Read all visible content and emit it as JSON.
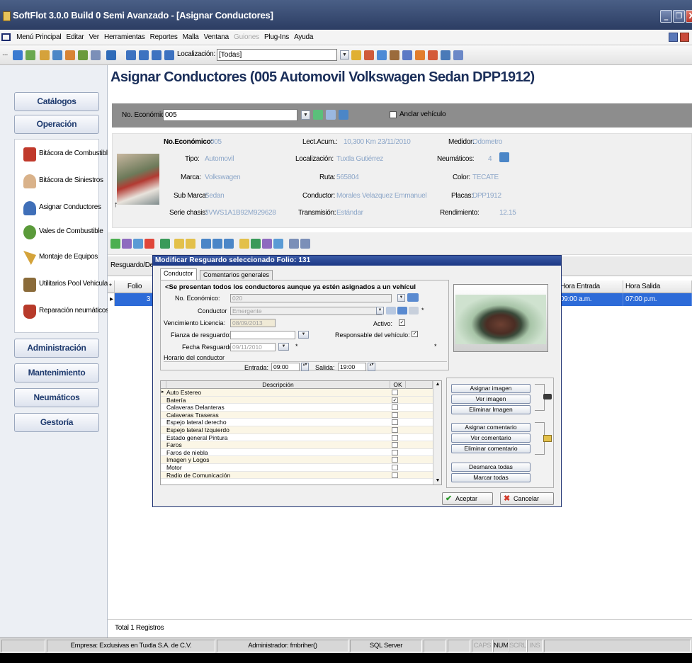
{
  "window": {
    "title": "SoftFlot 3.0.0 Build 0 Semi Avanzado - [Asignar Conductores]",
    "controls": [
      "_",
      "❐",
      "X"
    ]
  },
  "menubar": {
    "items": [
      "Menú Principal",
      "Editar",
      "Ver",
      "Herramientas",
      "Reportes",
      "Malla",
      "Ventana",
      "Guiones",
      "Plug-Ins",
      "Ayuda"
    ],
    "disabled_index": 7
  },
  "toolbar": {
    "prefix": "...",
    "location_label": "Localización:",
    "location_value": "[Todas]"
  },
  "sidebar": {
    "top_buttons": [
      "Catálogos",
      "Operación"
    ],
    "items": [
      "Bitácora de Combustible",
      "Bitácora de Siniestros",
      "Asignar Conductores",
      "Vales de Combustible",
      "Montaje de Equipos",
      "Utilitarios Pool Vehicular",
      "Reparación neumáticos"
    ],
    "bottom_buttons": [
      "Administración",
      "Mantenimiento",
      "Neumáticos",
      "Gestoría"
    ]
  },
  "main": {
    "heading": "Asignar Conductores (005 Automovil Volkswagen Sedan DPP1912)",
    "selector": {
      "no_economico_label": "No. Económico:",
      "no_economico_value": "005",
      "anclar_label": "Anclar vehículo"
    },
    "info": {
      "no_economico_label": "No.Económico:",
      "no_economico_value": "005",
      "tipo_label": "Tipo:",
      "tipo_value": "Automovil",
      "marca_label": "Marca:",
      "marca_value": "Volkswagen",
      "submarca_label": "Sub Marca:",
      "submarca_value": "Sedan",
      "serie_label": "Serie chasis:",
      "serie_value": "3VWS1A1B92M929628",
      "lect_label": "Lect.Acum.:",
      "lect_value": "10,300 Km 23/11/2010",
      "loc_label": "Localización:",
      "loc_value": "Tuxtla Gutiérrez",
      "ruta_label": "Ruta:",
      "ruta_value": "565804",
      "conductor_label": "Conductor:",
      "conductor_value": "Morales Velazquez Emmanuel",
      "trans_label": "Transmisión:",
      "trans_value": "Estándar",
      "medidor_label": "Medidor:",
      "medidor_value": "Odometro",
      "neum_label": "Neumáticos:",
      "neum_value": "4",
      "color_label": "Color:",
      "color_value": "TECATE",
      "placas_label": "Placas:",
      "placas_value": "DPP1912",
      "rend_label": "Rendimiento:",
      "rend_value": "12.15"
    },
    "tab_label": "Resguardo/Devo",
    "grid": {
      "headers": [
        "*",
        "Folio",
        "Hora Entrada",
        "Hora Salida"
      ],
      "row": [
        "3",
        "09:00 a.m.",
        "07:00 p.m."
      ]
    },
    "footer": "Total 1 Registros"
  },
  "dialog": {
    "title": "Modificar Resguardo seleccionado Folio: 131",
    "tabs": [
      "Conductor",
      "Comentarios generales"
    ],
    "notice": "<Se presentan todos los conductores aunque ya estén asignados a un vehícul",
    "no_economico_label": "No. Económico:",
    "no_economico_value": "020",
    "conductor_label": "Conductor",
    "conductor_value": "Emergente",
    "venc_label": "Vencimiento Licencia:",
    "venc_value": "08/09/2013",
    "activo_label": "Activo:",
    "fianza_label": "Fianza de resguardo:",
    "responsable_label": "Responsable del vehículo:",
    "fecha_label": "Fecha Resguardo:",
    "fecha_value": "09/11/2010",
    "horario_label": "Horario del conductor",
    "entrada_label": "Entrada:",
    "entrada_value": "09:00",
    "salida_label": "Salida:",
    "salida_value": "19:00",
    "asterisk": "*",
    "grid_headers": [
      "Descripción",
      "OK"
    ],
    "items": [
      {
        "name": "Auto Estereo",
        "ok": false
      },
      {
        "name": "Batería",
        "ok": true
      },
      {
        "name": "Calaveras Delanteras",
        "ok": false
      },
      {
        "name": "Calaveras Traseras",
        "ok": false
      },
      {
        "name": "Espejo lateral derecho",
        "ok": false
      },
      {
        "name": "Espejo lateral Izquierdo",
        "ok": false
      },
      {
        "name": "Estado general Pintura",
        "ok": false
      },
      {
        "name": "Faros",
        "ok": false
      },
      {
        "name": "Faros de niebla",
        "ok": false
      },
      {
        "name": "Imagen y Logos",
        "ok": false
      },
      {
        "name": "Motor",
        "ok": false
      },
      {
        "name": "Radio de Comunicación",
        "ok": false
      }
    ],
    "buttons": [
      "Asignar imagen",
      "Ver imagen",
      "Eliminar Imagen",
      "Asignar comentario",
      "Ver comentario",
      "Eliminar comentario",
      "Desmarca todas",
      "Marcar todas"
    ],
    "accept": "Aceptar",
    "cancel": "Cancelar"
  },
  "statusbar": {
    "empresa": "Empresa: Exclusivas en Tuxtla S.A. de C.V.",
    "usuario": "Administrador: fmbriher()",
    "db": "SQL Server",
    "keys": [
      "CAPS",
      "NUM",
      "SCRL",
      "INS"
    ]
  },
  "colors": {
    "title_bar": "#34476f",
    "selection": "#2d6bd8",
    "heading": "#1b2f5a",
    "dialog_title": "#1b3784"
  }
}
